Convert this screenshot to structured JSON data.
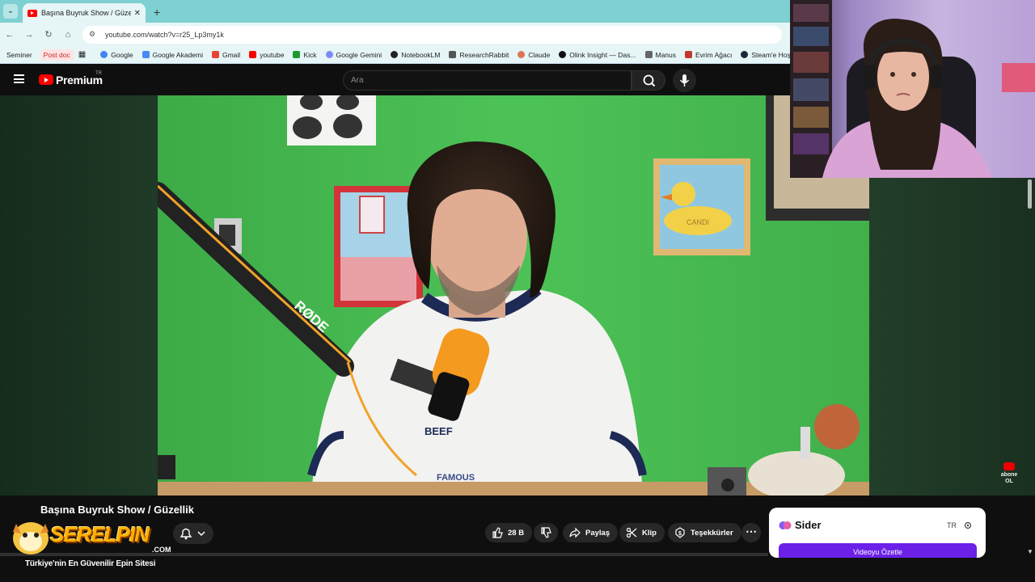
{
  "browser": {
    "tab_title": "Başına Buyruk Show / Güzellik",
    "url": "youtube.com/watch?v=r25_Lp3my1k",
    "bookmarks": {
      "chips": [
        "Seminer",
        "Post doc"
      ],
      "items": [
        "Google",
        "Google Akademi",
        "Gmail",
        "youtube",
        "Kick",
        "Google Gemini",
        "NotebookLM",
        "ResearchRabbit",
        "Claude",
        "Olink Insight — Das...",
        "Manus",
        "Evrim Ağacı",
        "Steam'e Hoş Gel"
      ]
    }
  },
  "youtube": {
    "logo_text": "Premium",
    "country": "TR",
    "search_placeholder": "Ara"
  },
  "video": {
    "title": "Başına Buyruk Show / Güzellik",
    "mic_brand": "RØDE",
    "shirt_text": "BEEF",
    "shirt_text2": "FAMOUS",
    "duck_sign": "CANDI",
    "watermark_line1": "abone",
    "watermark_line2": "OL"
  },
  "actions": {
    "likes": "28 B",
    "share": "Paylaş",
    "clip": "Klip",
    "thanks": "Teşekkürler"
  },
  "sponsor": {
    "logo": "SERELPIN",
    "domain": ".COM",
    "tagline": "Türkiye'nin En Güvenilir Epin Sitesi"
  },
  "sider": {
    "title": "Sider",
    "lang": "TR",
    "button": "Videoyu Özetle"
  }
}
